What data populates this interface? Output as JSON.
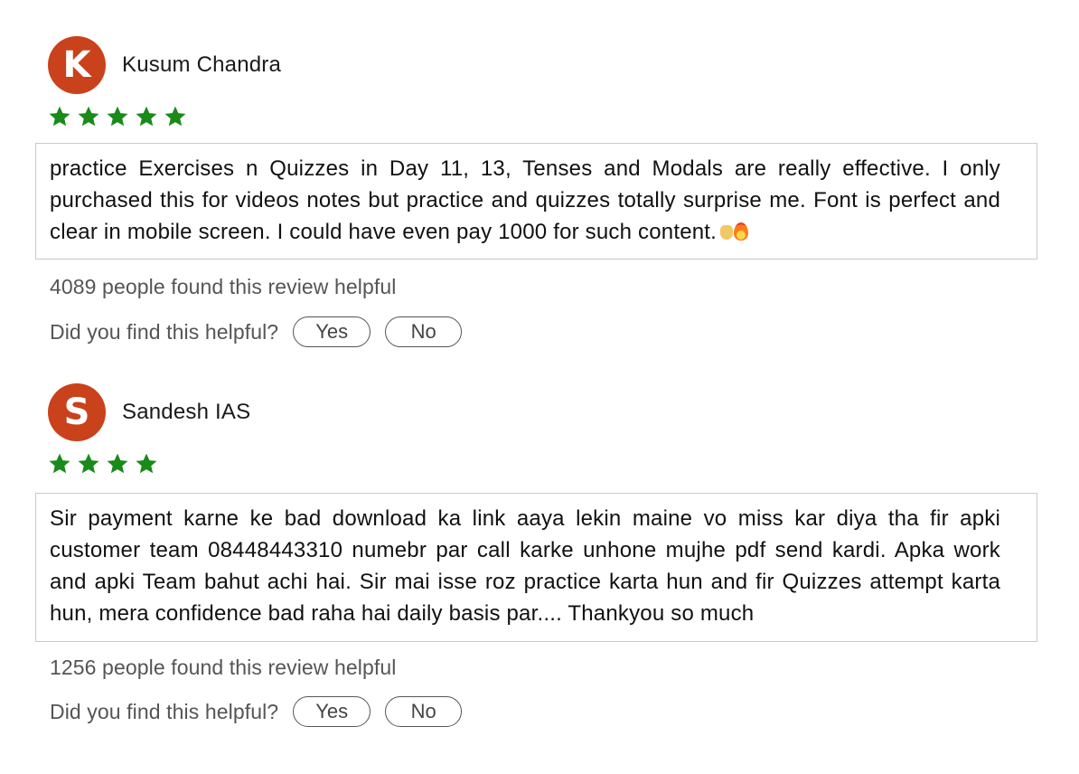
{
  "colors": {
    "avatar_bg": "#c9421b",
    "star": "#1a8a1a"
  },
  "reviews": [
    {
      "avatar_letter": "K",
      "name": "Kusum Chandra",
      "rating": 5,
      "text": "practice Exercises n Quizzes in Day 11, 13, Tenses and Modals are really effective. I only purchased this for videos notes but practice and quizzes totally surprise me. Font is perfect and clear in mobile screen. I could have even pay 1000 for such content.",
      "helpful_count_text": "4089 people found this review helpful",
      "helpful_question": "Did you find this helpful?",
      "yes_label": "Yes",
      "no_label": "No"
    },
    {
      "avatar_letter": "S",
      "name": "Sandesh IAS",
      "rating": 4,
      "text": "Sir payment karne ke bad download ka link aaya lekin maine vo miss kar diya tha fir apki customer team 08448443310 numebr par call karke unhone mujhe pdf send kardi. Apka work and apki Team bahut achi hai. Sir mai isse roz practice karta hun and fir Quizzes attempt karta hun, mera confidence bad raha hai daily basis par.... Thankyou so much",
      "helpful_count_text": "1256 people found this review helpful",
      "helpful_question": "Did you find this helpful?",
      "yes_label": "Yes",
      "no_label": "No"
    }
  ]
}
